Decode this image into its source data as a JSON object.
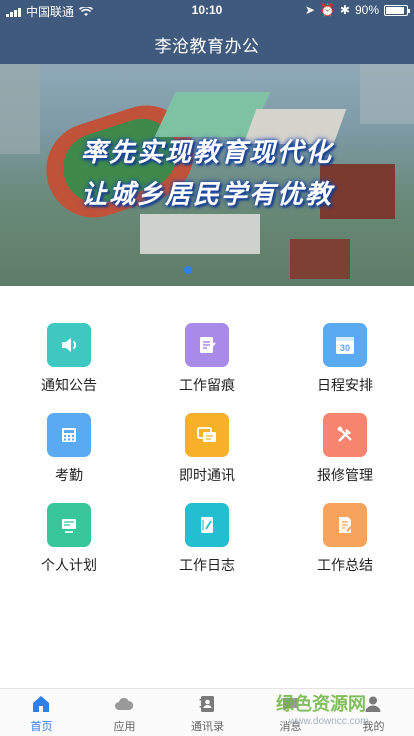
{
  "status_bar": {
    "carrier": "中国联通",
    "time": "10:10",
    "battery": "90%",
    "battery_level": 0.9
  },
  "header": {
    "title": "李沧教育办公"
  },
  "banner": {
    "line1": "率先实现教育现代化",
    "line2": "让城乡居民学有优教"
  },
  "menu": [
    {
      "label": "通知公告",
      "icon": "speaker-icon",
      "color": "#3fc8c0"
    },
    {
      "label": "工作留痕",
      "icon": "notepad-icon",
      "color": "#a98ae8"
    },
    {
      "label": "日程安排",
      "icon": "calendar-30-icon",
      "color": "#5aaaf2",
      "icon_text": "30"
    },
    {
      "label": "考勤",
      "icon": "calculator-icon",
      "color": "#5aaaf2"
    },
    {
      "label": "即时通讯",
      "icon": "chat-bubbles-icon",
      "color": "#f6b128"
    },
    {
      "label": "报修管理",
      "icon": "tools-icon",
      "color": "#f7846e"
    },
    {
      "label": "个人计划",
      "icon": "plan-icon",
      "color": "#37c79a"
    },
    {
      "label": "工作日志",
      "icon": "notebook-icon",
      "color": "#22bfd1"
    },
    {
      "label": "工作总结",
      "icon": "document-pen-icon",
      "color": "#f8a35c"
    }
  ],
  "tabs": [
    {
      "label": "首页",
      "icon": "home-icon",
      "active": true
    },
    {
      "label": "应用",
      "icon": "cloud-icon",
      "active": false
    },
    {
      "label": "通讯录",
      "icon": "contacts-book-icon",
      "active": false
    },
    {
      "label": "消息",
      "icon": "message-icon",
      "active": false
    },
    {
      "label": "我的",
      "icon": "user-icon",
      "active": false
    }
  ],
  "colors": {
    "header_bg": "#3f5a7d",
    "accent": "#2f7fe8"
  },
  "watermark": {
    "text": "绿色资源网",
    "url": "www.downcc.com"
  }
}
